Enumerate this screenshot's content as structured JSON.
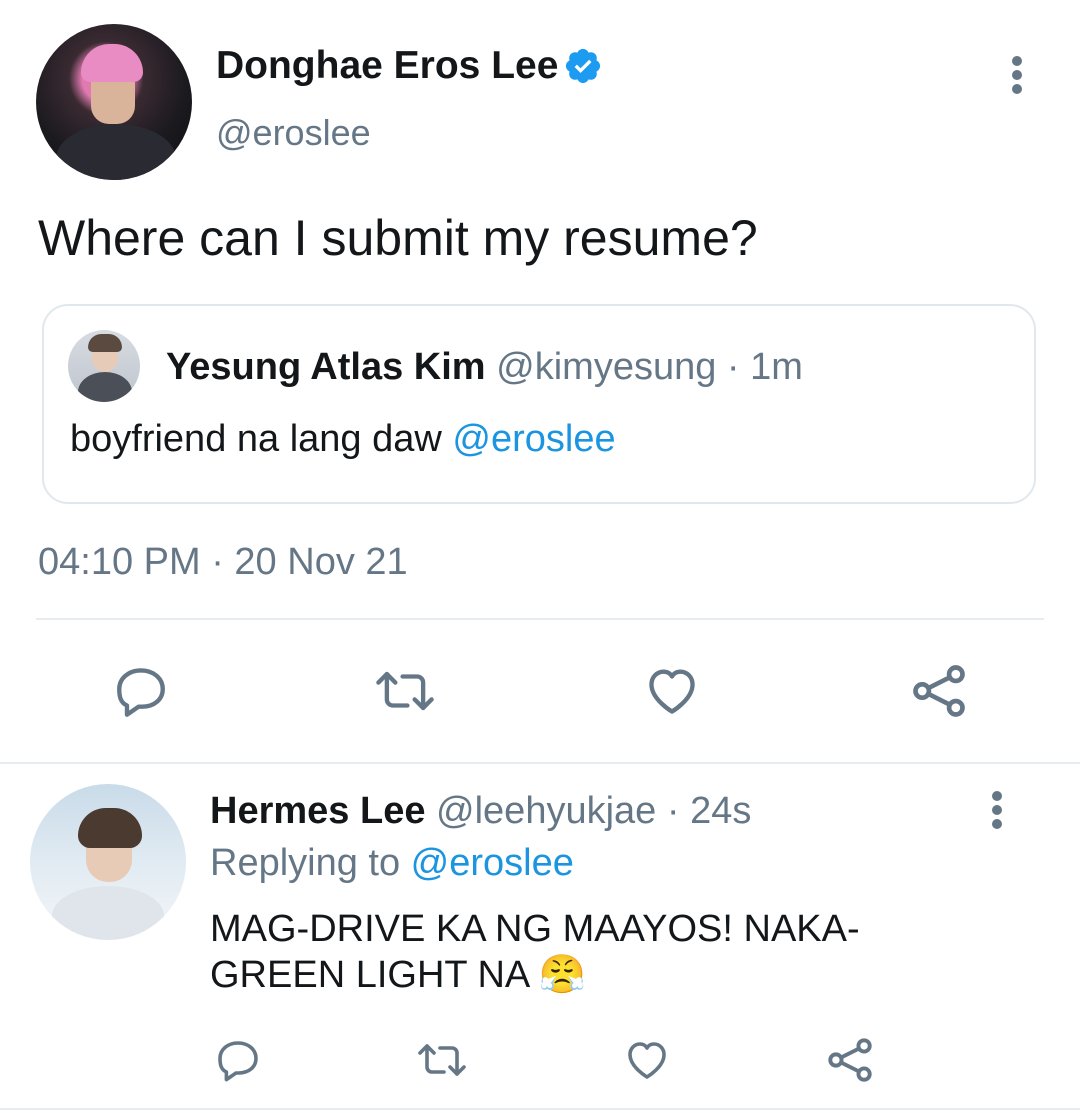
{
  "tweet": {
    "author_name": "Donghae Eros Lee",
    "author_handle": "@eroslee",
    "verified_icon": "verified-badge-icon",
    "more_icon": "more-vertical-icon",
    "text": "Where can I submit my resume?",
    "timestamp": "04:10 PM · 20 Nov 21",
    "quoted": {
      "author_name": "Yesung Atlas Kim",
      "author_handle": "@kimyesung",
      "time": "· 1m",
      "text_before": "boyfriend na lang daw ",
      "mention": "@eroslee"
    }
  },
  "actions": [
    "reply-icon",
    "retweet-icon",
    "like-icon",
    "share-icon"
  ],
  "reply": {
    "author_name": "Hermes Lee",
    "author_handle": "@leehyukjae",
    "time": "· 24s",
    "replying_prefix": "Replying to ",
    "replying_mention": "@eroslee",
    "text_line1": "MAG-DRIVE KA NG MAAYOS! NAKA-",
    "text_line2": "GREEN LIGHT NA",
    "emoji": "😤"
  },
  "colors": {
    "accent": "#1b95e0",
    "muted": "#657786",
    "text": "#14171a",
    "border": "#e1e8ed",
    "icon": "#657786"
  }
}
